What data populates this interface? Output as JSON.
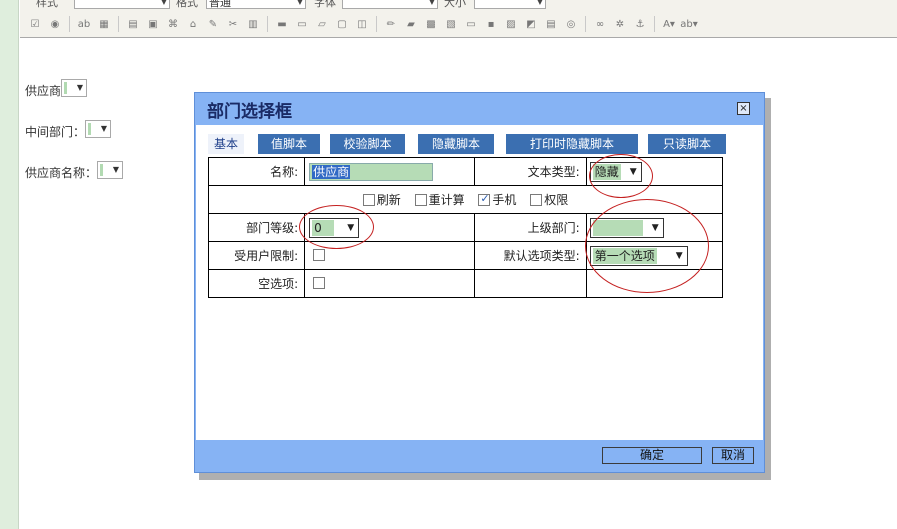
{
  "toolbar": {
    "style_label": "样式",
    "format_label": "格式",
    "format_value": "普通",
    "font_label": "字体",
    "size_label": "大小"
  },
  "form": {
    "supplier_label": "供应商",
    "middle_dept_label": "中间部门：",
    "supplier_name_label": "供应商名称："
  },
  "dialog": {
    "title": "部门选择框",
    "close_glyph": "×",
    "tabs": [
      {
        "label": "基本"
      },
      {
        "label": "值脚本"
      },
      {
        "label": "校验脚本"
      },
      {
        "label": "隐藏脚本"
      },
      {
        "label": "打印时隐藏脚本"
      },
      {
        "label": "只读脚本"
      }
    ],
    "fields": {
      "name_label": "名称:",
      "name_value": "供应商",
      "text_type_label": "文本类型:",
      "text_type_value": "隐藏",
      "refresh_label": "刷新",
      "recalc_label": "重计算",
      "mobile_label": "手机",
      "permission_label": "权限",
      "dept_level_label": "部门等级:",
      "dept_level_value": "0",
      "parent_dept_label": "上级部门:",
      "user_limit_label": "受用户限制:",
      "default_option_label": "默认选项类型:",
      "default_option_value": "第一个选项",
      "empty_option_label": "空选项:"
    },
    "checks": {
      "refresh": false,
      "recalc": false,
      "mobile": true,
      "permission": false,
      "user_limit": false,
      "empty_option": false
    },
    "buttons": {
      "ok": "确定",
      "cancel": "取消"
    }
  },
  "colors": {
    "dialog_bg": "#86b3f4",
    "tab_bg": "#3b6fb1",
    "field_fill": "#b6dcb6",
    "annotation": "#c42020"
  }
}
